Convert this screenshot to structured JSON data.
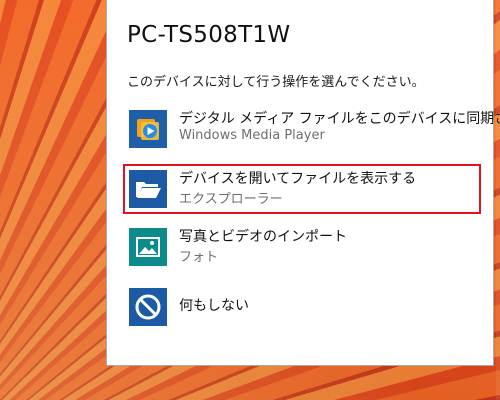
{
  "dialog": {
    "title": "PC-TS508T1W",
    "subtitle": "このデバイスに対して行う操作を選んでください。"
  },
  "options": [
    {
      "title": "デジタル メディア ファイルをこのデバイスに同期さ…",
      "app": "Windows Media Player",
      "icon": "windows-media-player-icon",
      "tile_color": "#1e5fa8"
    },
    {
      "title": "デバイスを開いてファイルを表示する",
      "app": "エクスプローラー",
      "icon": "folder-icon",
      "tile_color": "#1c5aa6",
      "selected": true
    },
    {
      "title": "写真とビデオのインポート",
      "app": "フォト",
      "icon": "photo-icon",
      "tile_color": "#0c8b8b"
    },
    {
      "title": "何もしない",
      "icon": "prohibited-icon",
      "tile_color": "#1c5aa6"
    }
  ],
  "colors": {
    "selection_border": "#e0141f",
    "panel_bg": "#ffffff"
  }
}
